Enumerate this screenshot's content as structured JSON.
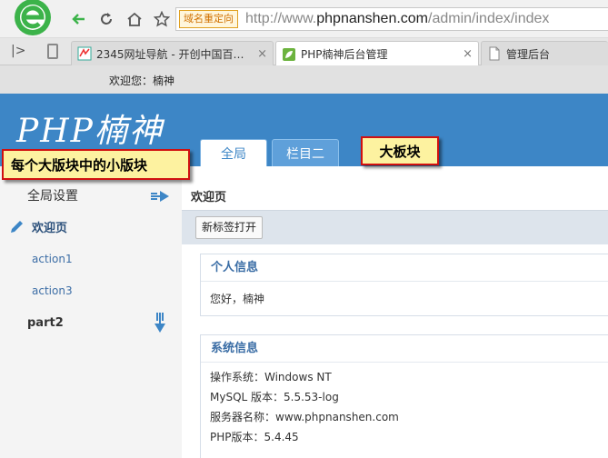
{
  "browser": {
    "redirect_badge": "域名重定向",
    "url_prefix": "http://www.",
    "url_host": "phpnanshen.com",
    "url_path": "/admin/index/index",
    "tabs": [
      {
        "title": "2345网址导航 - 开创中国百年品",
        "close": "×"
      },
      {
        "title": "PHP楠神后台管理",
        "close": "×"
      },
      {
        "title": "管理后台",
        "close": ""
      }
    ]
  },
  "page": {
    "welcome": "欢迎您：楠神",
    "brand": "PHP楠神",
    "top_tabs": [
      "全局",
      "栏目二"
    ],
    "callouts": {
      "sub_block": "每个大版块中的小版块",
      "big_block": "大板块"
    },
    "sidebar": {
      "group1": "全局设置",
      "active_item": "欢迎页",
      "items": [
        "action1",
        "action3"
      ],
      "group2": "part2"
    },
    "content": {
      "title": "欢迎页",
      "new_tab_button": "新标签打开",
      "personal_panel": {
        "title": "个人信息",
        "greeting": "您好，楠神"
      },
      "system_panel": {
        "title": "系统信息",
        "rows": [
          "操作系统：Windows NT",
          "MySQL 版本：5.5.53-log",
          "服务器名称：www.phpnanshen.com",
          "PHP版本：5.4.45"
        ]
      }
    }
  },
  "colors": {
    "header_blue": "#3d86c6",
    "callout_fill": "#fdf2a0",
    "callout_border": "#d01010"
  }
}
